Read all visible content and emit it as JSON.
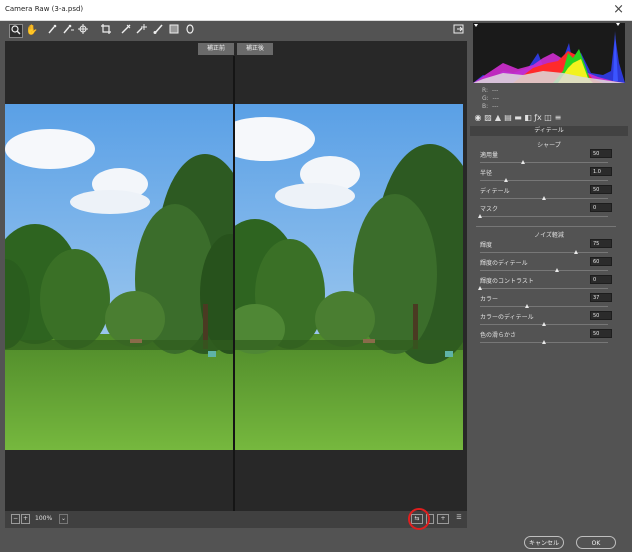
{
  "window": {
    "title": "Camera Raw (3-a.psd)",
    "close": "×"
  },
  "toolbar": {
    "tools": [
      "zoom-icon",
      "hand-icon",
      "white-balance-icon",
      "color-sampler-icon",
      "target-adjust-icon",
      "crop-icon",
      "straighten-icon",
      "spot-removal-icon",
      "adjustment-brush-icon",
      "graduated-filter-icon",
      "radial-filter-icon"
    ],
    "fullscreen": "fullscreen-icon"
  },
  "preview": {
    "before_label": "補正前",
    "after_label": "補正後"
  },
  "bottombar": {
    "zoom_value": "100%",
    "view_modes": [
      "before-after-side-icon",
      "before-after-split-icon",
      "swap-icon",
      "preview-settings-icon"
    ]
  },
  "histogram": {
    "rgb_labels": [
      "R:",
      "G:",
      "B:"
    ],
    "rgb_values": [
      "---",
      "---",
      "---"
    ]
  },
  "panel": {
    "section_title": "ディテール",
    "sharpen": {
      "title": "シャープ",
      "sliders": [
        {
          "name": "適用量",
          "value": "50",
          "fraction": 0.333
        },
        {
          "name": "半径",
          "value": "1.0",
          "fraction": 0.2
        },
        {
          "name": "ディテール",
          "value": "50",
          "fraction": 0.5
        },
        {
          "name": "マスク",
          "value": "0",
          "fraction": 0.0
        }
      ]
    },
    "noise": {
      "title": "ノイズ軽減",
      "sliders": [
        {
          "name": "輝度",
          "value": "75",
          "fraction": 0.75
        },
        {
          "name": "輝度のディテール",
          "value": "60",
          "fraction": 0.6
        },
        {
          "name": "輝度のコントラスト",
          "value": "0",
          "fraction": 0.0
        },
        {
          "name": "カラー",
          "value": "37",
          "fraction": 0.37
        },
        {
          "name": "カラーのディテール",
          "value": "50",
          "fraction": 0.5
        },
        {
          "name": "色の滑らかさ",
          "value": "50",
          "fraction": 0.5
        }
      ]
    }
  },
  "buttons": {
    "cancel": "キャンセル",
    "ok": "OK"
  }
}
